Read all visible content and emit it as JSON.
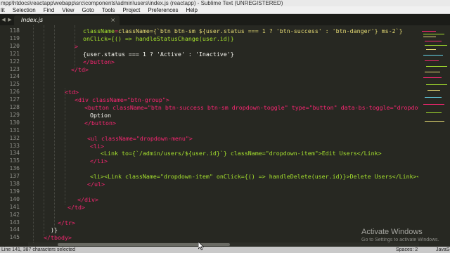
{
  "window": {
    "title": "mpp\\htdocs\\reactapp\\webapp\\src\\components\\admin\\users\\index.js (reactapp) - Sublime Text (UNREGISTERED)"
  },
  "menu": [
    "lit",
    "Selection",
    "Find",
    "View",
    "Goto",
    "Tools",
    "Project",
    "Preferences",
    "Help"
  ],
  "tab": {
    "label": "Index.js",
    "close": "×"
  },
  "line_numbers": [
    "118",
    "119",
    "120",
    "121",
    "122",
    "123",
    "124",
    "125",
    "126",
    "127",
    "128",
    "129",
    "130",
    "131",
    "132",
    "133",
    "134",
    "135",
    "136",
    "137",
    "138",
    "139",
    "140",
    "141",
    "142",
    "143",
    "144",
    "145",
    "146"
  ],
  "code": {
    "l118": [
      "className={`btn btn-sm ${user.status === 1 ? 'btn-success' : 'btn-danger'} ms-2`}"
    ],
    "l119": [
      "onClick={() => handleStatusChange(user.id)}"
    ],
    "l120": [
      ">"
    ],
    "l121": [
      "{user.status === 1 ? 'Active' : 'Inactive'}"
    ],
    "l122": [
      "</button>"
    ],
    "l123": [
      "</td>"
    ],
    "l126": [
      "<td>"
    ],
    "l127": [
      "<div className=\"btn-group\">"
    ],
    "l128": [
      "<button className=\"btn btn-success btn-sm dropdown-toggle\" type=\"button\" data-bs-toggle=\"dropdown\">"
    ],
    "l129": [
      "Option"
    ],
    "l130": [
      "</button>"
    ],
    "l132": [
      "<ul className=\"dropdown-menu\">"
    ],
    "l133": [
      "<li>"
    ],
    "l134": [
      "<Link to={`/admin/users/${user.id}`} className=\"dropdown-item\">Edit Users</Link>"
    ],
    "l135": [
      "</li>"
    ],
    "l137": [
      "<li><Link className=\"dropdown-item\" onClick={() => handleDelete(user.id)}>Delete Users</Link></li>"
    ],
    "l138": [
      "</ul>"
    ],
    "l140": [
      "</div>"
    ],
    "l141": [
      "</td>"
    ],
    "l143": [
      "</tr>"
    ],
    "l144": [
      ")}"
    ],
    "l145": [
      "</tbody>"
    ]
  },
  "watermark": {
    "line1": "Activate Windows",
    "line2": "Go to Settings to activate Windows."
  },
  "status": {
    "left": "Line 141, 387 characters selected",
    "spaces": "Spaces: 2",
    "syntax": "JavaScript"
  },
  "colors": {
    "background": "#272822",
    "tag": "#f92672",
    "attribute": "#a6e22e",
    "string": "#e6db74",
    "number": "#ae81ff",
    "function": "#66d9ef"
  }
}
